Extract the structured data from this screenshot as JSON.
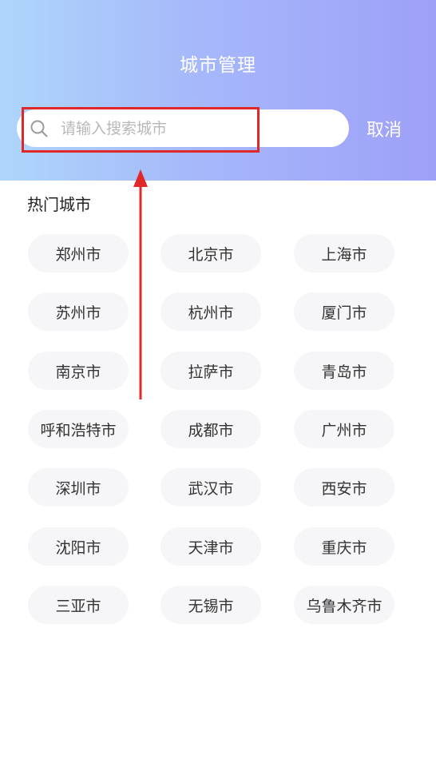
{
  "header": {
    "title": "城市管理",
    "cancel_label": "取消"
  },
  "search": {
    "placeholder": "请输入搜索城市",
    "icon": "search-icon"
  },
  "hot_cities": {
    "title": "热门城市",
    "items": [
      "郑州市",
      "北京市",
      "上海市",
      "苏州市",
      "杭州市",
      "厦门市",
      "南京市",
      "拉萨市",
      "青岛市",
      "呼和浩特市",
      "成都市",
      "广州市",
      "深圳市",
      "武汉市",
      "西安市",
      "沈阳市",
      "天津市",
      "重庆市",
      "三亚市",
      "无锡市",
      "乌鲁木齐市"
    ]
  },
  "colors": {
    "annotation_red": "#e0282a",
    "header_gradient_start": "#aed6fb",
    "header_gradient_end": "#9ea0f8"
  }
}
